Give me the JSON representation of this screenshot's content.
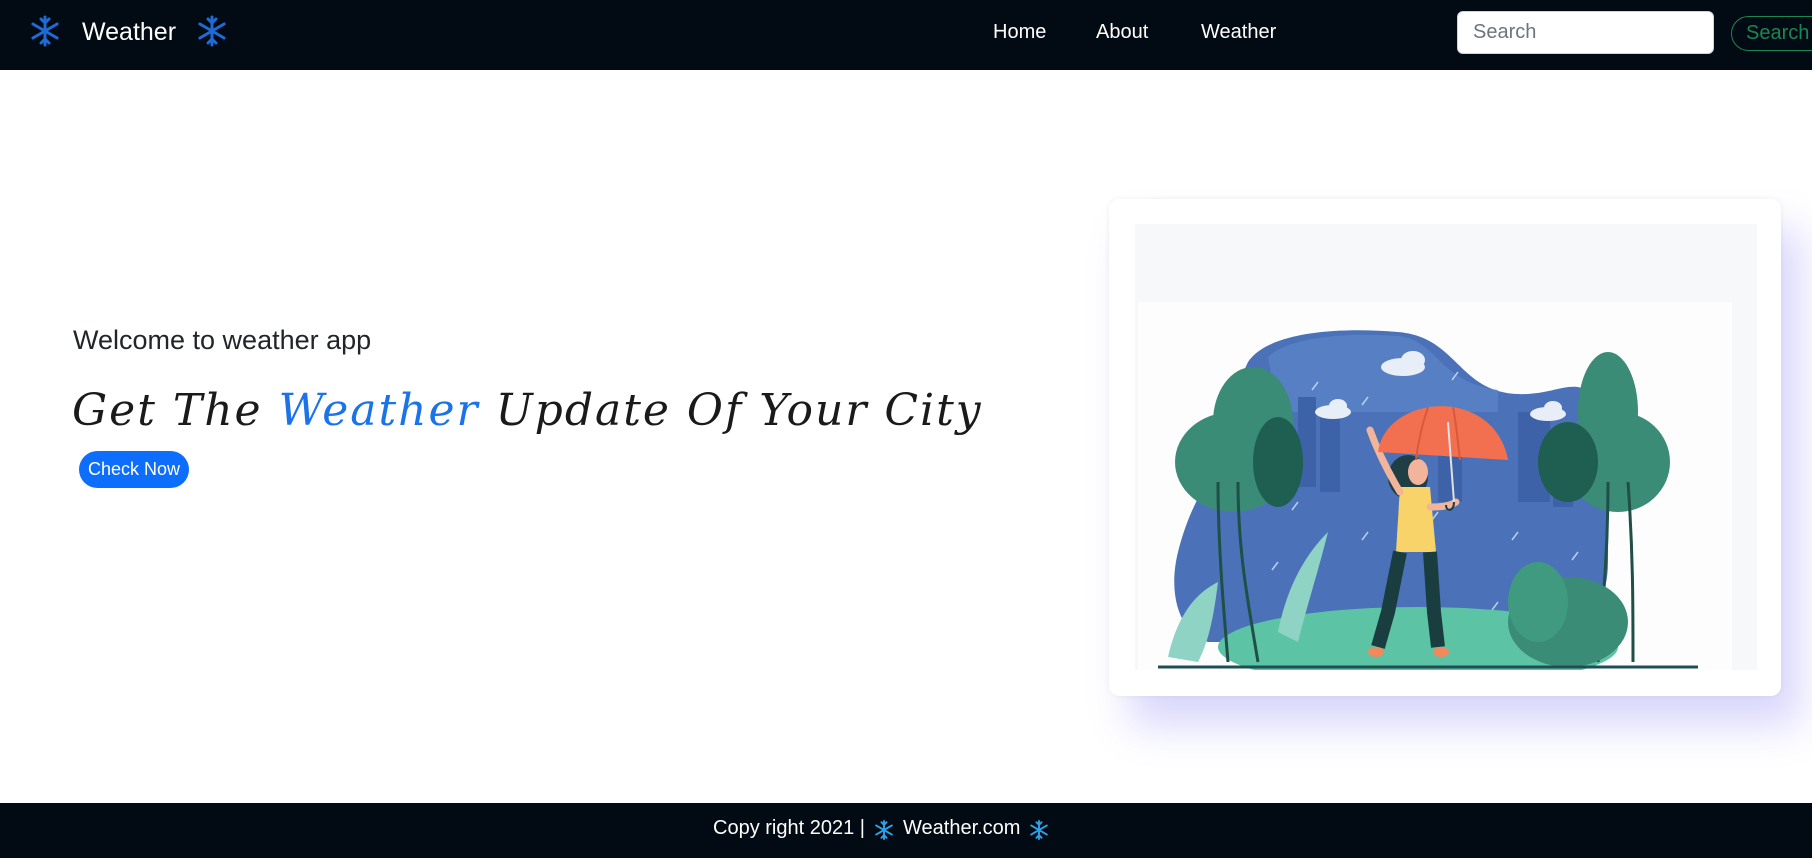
{
  "navbar": {
    "brand_left_icon": "snowflake-icon",
    "brand": "Weather",
    "brand_right_icon": "snowflake-icon",
    "links": [
      "Home",
      "About",
      "Weather"
    ],
    "search_placeholder": "Search",
    "search_button": "Search"
  },
  "hero": {
    "welcome": "Welcome to weather app",
    "headline_before": "Get The ",
    "headline_accent": "Weather",
    "headline_after": " Update Of Your City",
    "button": "Check Now"
  },
  "illustration": {
    "icon": "woman-with-umbrella-in-rain-illustration"
  },
  "footer": {
    "copyright": "Copy right 2021 |",
    "site": "Weather.com",
    "icon": "snowflake-icon"
  },
  "colors": {
    "navbar_bg": "#020a14",
    "accent_blue": "#0d6efd",
    "headline_accent": "#1a73e8",
    "search_green": "#198754",
    "footer_icon": "#2aa3e8"
  }
}
